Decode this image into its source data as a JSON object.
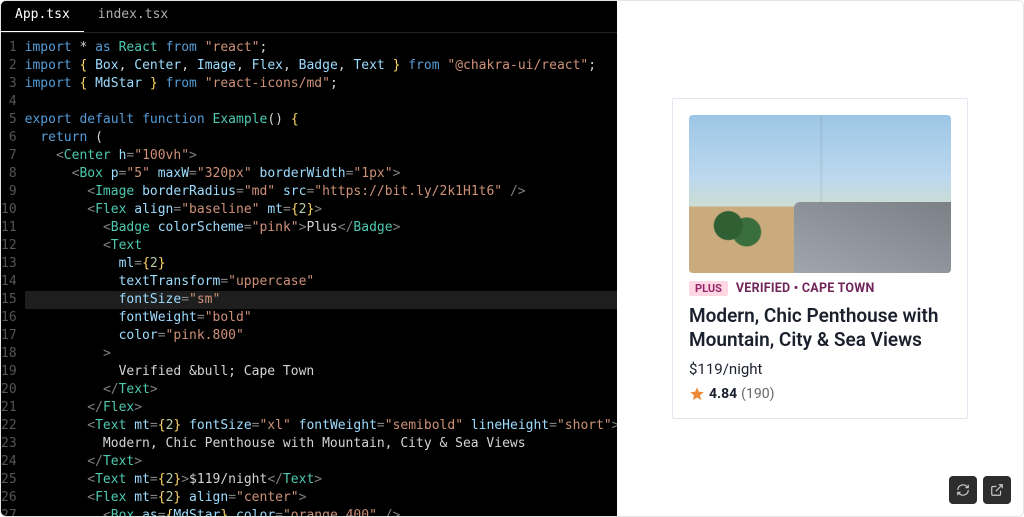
{
  "tabs": [
    {
      "label": "App.tsx",
      "active": true
    },
    {
      "label": "index.tsx",
      "active": false
    }
  ],
  "cursor_line": 15,
  "code": [
    [
      [
        "kw",
        "import "
      ],
      [
        "punc",
        "* "
      ],
      [
        "kw",
        "as "
      ],
      [
        "comp",
        "React"
      ],
      [
        "plain",
        " "
      ],
      [
        "kw",
        "from"
      ],
      [
        "plain",
        " "
      ],
      [
        "str",
        "\"react\""
      ],
      [
        "punc",
        ";"
      ]
    ],
    [
      [
        "kw",
        "import "
      ],
      [
        "brace",
        "{ "
      ],
      [
        "id",
        "Box"
      ],
      [
        "punc",
        ", "
      ],
      [
        "id",
        "Center"
      ],
      [
        "punc",
        ", "
      ],
      [
        "id",
        "Image"
      ],
      [
        "punc",
        ", "
      ],
      [
        "id",
        "Flex"
      ],
      [
        "punc",
        ", "
      ],
      [
        "id",
        "Badge"
      ],
      [
        "punc",
        ", "
      ],
      [
        "id",
        "Text"
      ],
      [
        "brace",
        " }"
      ],
      [
        "plain",
        " "
      ],
      [
        "kw",
        "from"
      ],
      [
        "plain",
        " "
      ],
      [
        "str",
        "\"@chakra-ui/react\""
      ],
      [
        "punc",
        ";"
      ]
    ],
    [
      [
        "kw",
        "import "
      ],
      [
        "brace",
        "{ "
      ],
      [
        "id",
        "MdStar"
      ],
      [
        "brace",
        " }"
      ],
      [
        "plain",
        " "
      ],
      [
        "kw",
        "from"
      ],
      [
        "plain",
        " "
      ],
      [
        "str",
        "\"react-icons/md\""
      ],
      [
        "punc",
        ";"
      ]
    ],
    [],
    [
      [
        "kw",
        "export "
      ],
      [
        "kw",
        "default "
      ],
      [
        "kw",
        "function "
      ],
      [
        "comp",
        "Example"
      ],
      [
        "punc",
        "()"
      ],
      [
        "plain",
        " "
      ],
      [
        "brace",
        "{"
      ]
    ],
    [
      [
        "plain",
        "  "
      ],
      [
        "kw",
        "return"
      ],
      [
        "plain",
        " "
      ],
      [
        "punc",
        "("
      ]
    ],
    [
      [
        "plain",
        "    "
      ],
      [
        "op",
        "<"
      ],
      [
        "comp",
        "Center"
      ],
      [
        "plain",
        " "
      ],
      [
        "id",
        "h"
      ],
      [
        "op",
        "="
      ],
      [
        "str",
        "\"100vh\""
      ],
      [
        "op",
        ">"
      ]
    ],
    [
      [
        "plain",
        "      "
      ],
      [
        "op",
        "<"
      ],
      [
        "comp",
        "Box"
      ],
      [
        "plain",
        " "
      ],
      [
        "id",
        "p"
      ],
      [
        "op",
        "="
      ],
      [
        "str",
        "\"5\""
      ],
      [
        "plain",
        " "
      ],
      [
        "id",
        "maxW"
      ],
      [
        "op",
        "="
      ],
      [
        "str",
        "\"320px\""
      ],
      [
        "plain",
        " "
      ],
      [
        "id",
        "borderWidth"
      ],
      [
        "op",
        "="
      ],
      [
        "str",
        "\"1px\""
      ],
      [
        "op",
        ">"
      ]
    ],
    [
      [
        "plain",
        "        "
      ],
      [
        "op",
        "<"
      ],
      [
        "comp",
        "Image"
      ],
      [
        "plain",
        " "
      ],
      [
        "id",
        "borderRadius"
      ],
      [
        "op",
        "="
      ],
      [
        "str",
        "\"md\""
      ],
      [
        "plain",
        " "
      ],
      [
        "id",
        "src"
      ],
      [
        "op",
        "="
      ],
      [
        "str",
        "\"https://bit.ly/2k1H1t6\""
      ],
      [
        "plain",
        " "
      ],
      [
        "op",
        "/>"
      ]
    ],
    [
      [
        "plain",
        "        "
      ],
      [
        "op",
        "<"
      ],
      [
        "comp",
        "Flex"
      ],
      [
        "plain",
        " "
      ],
      [
        "id",
        "align"
      ],
      [
        "op",
        "="
      ],
      [
        "str",
        "\"baseline\""
      ],
      [
        "plain",
        " "
      ],
      [
        "id",
        "mt"
      ],
      [
        "op",
        "="
      ],
      [
        "brace",
        "{"
      ],
      [
        "num",
        "2"
      ],
      [
        "brace",
        "}"
      ],
      [
        "op",
        ">"
      ]
    ],
    [
      [
        "plain",
        "          "
      ],
      [
        "op",
        "<"
      ],
      [
        "comp",
        "Badge"
      ],
      [
        "plain",
        " "
      ],
      [
        "id",
        "colorScheme"
      ],
      [
        "op",
        "="
      ],
      [
        "str",
        "\"pink\""
      ],
      [
        "op",
        ">"
      ],
      [
        "plain",
        "Plus"
      ],
      [
        "op",
        "</"
      ],
      [
        "comp",
        "Badge"
      ],
      [
        "op",
        ">"
      ]
    ],
    [
      [
        "plain",
        "          "
      ],
      [
        "op",
        "<"
      ],
      [
        "comp",
        "Text"
      ]
    ],
    [
      [
        "plain",
        "            "
      ],
      [
        "id",
        "ml"
      ],
      [
        "op",
        "="
      ],
      [
        "brace",
        "{"
      ],
      [
        "num",
        "2"
      ],
      [
        "brace",
        "}"
      ]
    ],
    [
      [
        "plain",
        "            "
      ],
      [
        "id",
        "textTransform"
      ],
      [
        "op",
        "="
      ],
      [
        "str",
        "\"uppercase\""
      ]
    ],
    [
      [
        "plain",
        "            "
      ],
      [
        "id",
        "fontSize"
      ],
      [
        "op",
        "="
      ],
      [
        "str",
        "\"sm\""
      ]
    ],
    [
      [
        "plain",
        "            "
      ],
      [
        "id",
        "fontWeight"
      ],
      [
        "op",
        "="
      ],
      [
        "str",
        "\"bold\""
      ]
    ],
    [
      [
        "plain",
        "            "
      ],
      [
        "id",
        "color"
      ],
      [
        "op",
        "="
      ],
      [
        "str",
        "\"pink.800\""
      ]
    ],
    [
      [
        "plain",
        "          "
      ],
      [
        "op",
        ">"
      ]
    ],
    [
      [
        "plain",
        "            Verified &bull; Cape Town"
      ]
    ],
    [
      [
        "plain",
        "          "
      ],
      [
        "op",
        "</"
      ],
      [
        "comp",
        "Text"
      ],
      [
        "op",
        ">"
      ]
    ],
    [
      [
        "plain",
        "        "
      ],
      [
        "op",
        "</"
      ],
      [
        "comp",
        "Flex"
      ],
      [
        "op",
        ">"
      ]
    ],
    [
      [
        "plain",
        "        "
      ],
      [
        "op",
        "<"
      ],
      [
        "comp",
        "Text"
      ],
      [
        "plain",
        " "
      ],
      [
        "id",
        "mt"
      ],
      [
        "op",
        "="
      ],
      [
        "brace",
        "{"
      ],
      [
        "num",
        "2"
      ],
      [
        "brace",
        "}"
      ],
      [
        "plain",
        " "
      ],
      [
        "id",
        "fontSize"
      ],
      [
        "op",
        "="
      ],
      [
        "str",
        "\"xl\""
      ],
      [
        "plain",
        " "
      ],
      [
        "id",
        "fontWeight"
      ],
      [
        "op",
        "="
      ],
      [
        "str",
        "\"semibold\""
      ],
      [
        "plain",
        " "
      ],
      [
        "id",
        "lineHeight"
      ],
      [
        "op",
        "="
      ],
      [
        "str",
        "\"short\""
      ],
      [
        "op",
        ">"
      ]
    ],
    [
      [
        "plain",
        "          Modern, Chic Penthouse with Mountain, City & Sea Views"
      ]
    ],
    [
      [
        "plain",
        "        "
      ],
      [
        "op",
        "</"
      ],
      [
        "comp",
        "Text"
      ],
      [
        "op",
        ">"
      ]
    ],
    [
      [
        "plain",
        "        "
      ],
      [
        "op",
        "<"
      ],
      [
        "comp",
        "Text"
      ],
      [
        "plain",
        " "
      ],
      [
        "id",
        "mt"
      ],
      [
        "op",
        "="
      ],
      [
        "brace",
        "{"
      ],
      [
        "num",
        "2"
      ],
      [
        "brace",
        "}"
      ],
      [
        "op",
        ">"
      ],
      [
        "plain",
        "$119/night"
      ],
      [
        "op",
        "</"
      ],
      [
        "comp",
        "Text"
      ],
      [
        "op",
        ">"
      ]
    ],
    [
      [
        "plain",
        "        "
      ],
      [
        "op",
        "<"
      ],
      [
        "comp",
        "Flex"
      ],
      [
        "plain",
        " "
      ],
      [
        "id",
        "mt"
      ],
      [
        "op",
        "="
      ],
      [
        "brace",
        "{"
      ],
      [
        "num",
        "2"
      ],
      [
        "brace",
        "}"
      ],
      [
        "plain",
        " "
      ],
      [
        "id",
        "align"
      ],
      [
        "op",
        "="
      ],
      [
        "str",
        "\"center\""
      ],
      [
        "op",
        ">"
      ]
    ],
    [
      [
        "plain",
        "          "
      ],
      [
        "op",
        "<"
      ],
      [
        "comp",
        "Box"
      ],
      [
        "plain",
        " "
      ],
      [
        "id",
        "as"
      ],
      [
        "op",
        "="
      ],
      [
        "brace",
        "{"
      ],
      [
        "id",
        "MdStar"
      ],
      [
        "brace",
        "}"
      ],
      [
        "plain",
        " "
      ],
      [
        "id",
        "color"
      ],
      [
        "op",
        "="
      ],
      [
        "str",
        "\"orange.400\""
      ],
      [
        "plain",
        " "
      ],
      [
        "op",
        "/>"
      ]
    ]
  ],
  "preview": {
    "badge": "PLUS",
    "verified": "VERIFIED • CAPE TOWN",
    "title": "Modern, Chic Penthouse with Mountain, City & Sea Views",
    "price": "$119/night",
    "rating": "4.84",
    "rating_count": "(190)"
  },
  "toolbar": {
    "refresh_label": "Refresh",
    "open_label": "Open"
  }
}
